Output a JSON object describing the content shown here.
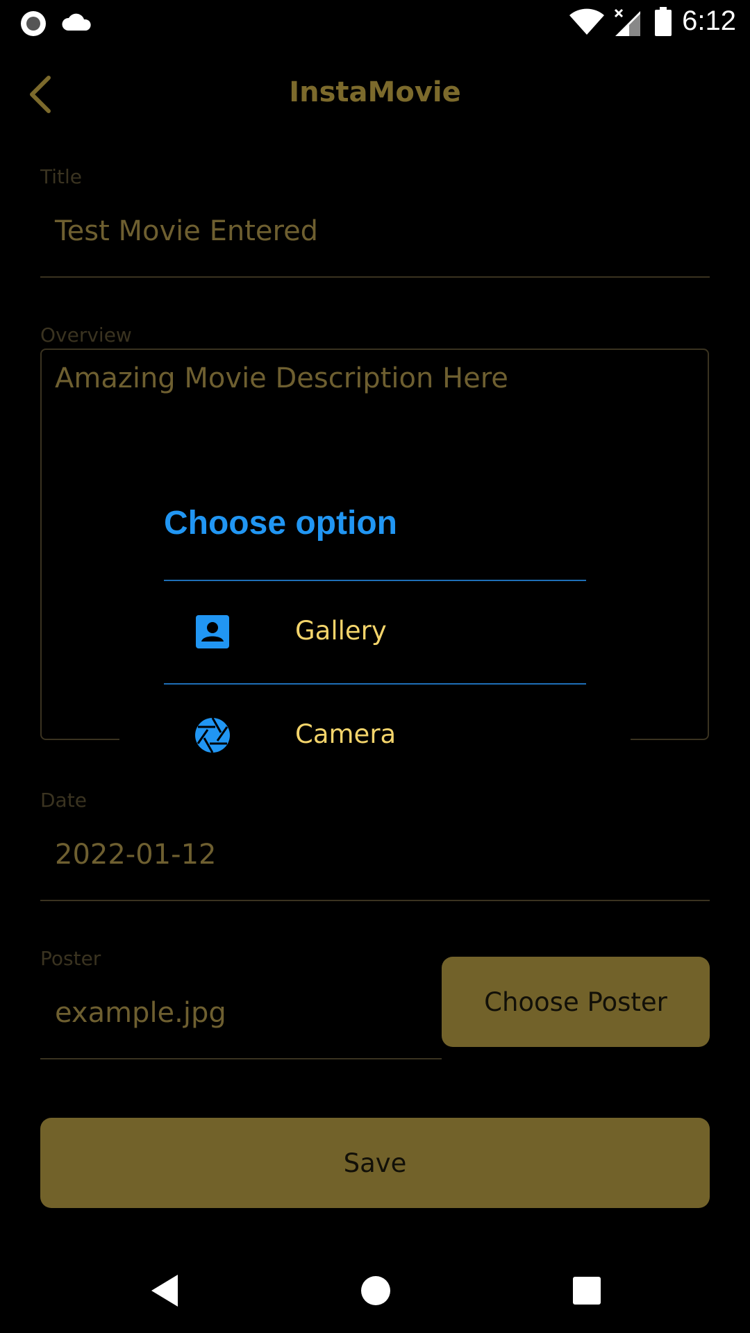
{
  "status_bar": {
    "time": "6:12",
    "icons": [
      "record-icon",
      "cloud-icon",
      "wifi-icon",
      "signal-icon",
      "battery-icon"
    ]
  },
  "app_bar": {
    "title": "InstaMovie",
    "back_icon": "chevron-left-icon"
  },
  "form": {
    "title_label": "Title",
    "title_value": "Test Movie Entered",
    "overview_label": "Overview",
    "overview_value": "Amazing Movie Description Here",
    "date_label": "Date",
    "date_value": "2022-01-12",
    "poster_label": "Poster",
    "poster_value": "example.jpg",
    "choose_poster_label": "Choose Poster",
    "save_label": "Save"
  },
  "dialog": {
    "title": "Choose option",
    "options": [
      {
        "label": "Gallery",
        "icon": "contact-portrait-icon"
      },
      {
        "label": "Camera",
        "icon": "camera-shutter-icon"
      }
    ]
  },
  "colors": {
    "accent": "#7c6a2c",
    "button": "#72622a",
    "dialog_title": "#2196f3",
    "dialog_item_text": "#f3d46b"
  }
}
